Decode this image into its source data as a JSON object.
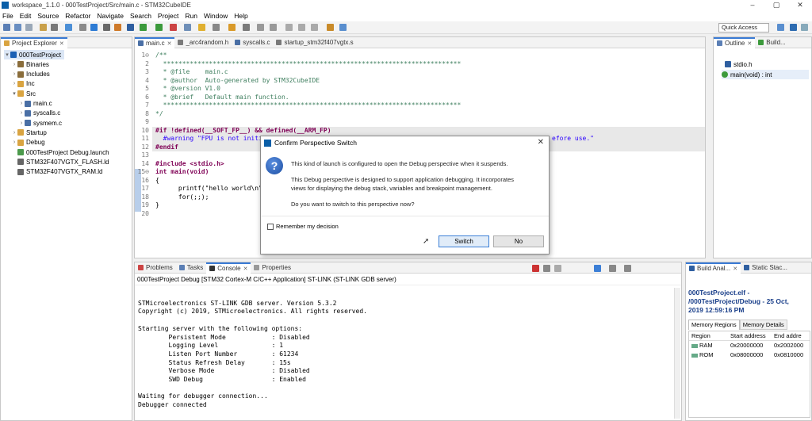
{
  "window": {
    "title": "workspace_1.1.0 - 000TestProject/Src/main.c - STM32CubeIDE"
  },
  "menu": [
    "File",
    "Edit",
    "Source",
    "Refactor",
    "Navigate",
    "Search",
    "Project",
    "Run",
    "Window",
    "Help"
  ],
  "quick_access": "Quick Access",
  "project_explorer": {
    "tab": "Project Explorer",
    "items": [
      {
        "label": "000TestProject",
        "level": 0,
        "arrow": "▾",
        "icon": "project-icon",
        "color": "#1a5fb4"
      },
      {
        "label": "Binaries",
        "level": 1,
        "arrow": "›",
        "icon": "binaries-icon",
        "color": "#8a6d3b"
      },
      {
        "label": "Includes",
        "level": 1,
        "arrow": "›",
        "icon": "includes-icon",
        "color": "#8a6d3b"
      },
      {
        "label": "Inc",
        "level": 1,
        "arrow": "›",
        "icon": "folder-icon",
        "color": "#d9a441"
      },
      {
        "label": "Src",
        "level": 1,
        "arrow": "▾",
        "icon": "folder-icon",
        "color": "#d9a441"
      },
      {
        "label": "main.c",
        "level": 2,
        "arrow": "›",
        "icon": "c-file-icon",
        "color": "#4a6fa5"
      },
      {
        "label": "syscalls.c",
        "level": 2,
        "arrow": "›",
        "icon": "c-file-icon",
        "color": "#4a6fa5"
      },
      {
        "label": "sysmem.c",
        "level": 2,
        "arrow": "›",
        "icon": "c-file-icon",
        "color": "#4a6fa5"
      },
      {
        "label": "Startup",
        "level": 1,
        "arrow": "›",
        "icon": "folder-icon",
        "color": "#d9a441"
      },
      {
        "label": "Debug",
        "level": 1,
        "arrow": "›",
        "icon": "folder-icon",
        "color": "#d9a441"
      },
      {
        "label": "000TestProject Debug.launch",
        "level": 1,
        "arrow": "",
        "icon": "launch-icon",
        "color": "#4c9a4c"
      },
      {
        "label": "STM32F407VGTX_FLASH.ld",
        "level": 1,
        "arrow": "",
        "icon": "ld-file-icon",
        "color": "#666666"
      },
      {
        "label": "STM32F407VGTX_RAM.ld",
        "level": 1,
        "arrow": "",
        "icon": "ld-file-icon",
        "color": "#666666"
      }
    ]
  },
  "editor": {
    "tabs": [
      "main.c",
      "_arc4random.h",
      "syscalls.c",
      "startup_stm32f407vgtx.s"
    ],
    "lines": [
      {
        "n": "1⊖",
        "t": "/**",
        "c": "cmt"
      },
      {
        "n": "2",
        "t": "  ******************************************************************************",
        "c": "cmt"
      },
      {
        "n": "3",
        "t": "  * @file    main.c",
        "c": "cmt"
      },
      {
        "n": "4",
        "t": "  * @author  Auto-generated by STM32CubeIDE",
        "c": "cmt"
      },
      {
        "n": "5",
        "t": "  * @version V1.0",
        "c": "cmt"
      },
      {
        "n": "6",
        "t": "  * @brief   Default main function.",
        "c": "cmt"
      },
      {
        "n": "7",
        "t": "  ******************************************************************************",
        "c": "cmt"
      },
      {
        "n": "8",
        "t": "*/",
        "c": "cmt"
      },
      {
        "n": "9",
        "t": "",
        "c": ""
      },
      {
        "n": "10",
        "t": "#if !defined(__SOFT_FP__) && defined(__ARM_FP)",
        "c": "kw"
      },
      {
        "n": "11",
        "t": "  #warning \"FPU is not initi",
        "c": "str"
      },
      {
        "n": "12",
        "t": "#endif",
        "c": "kw"
      },
      {
        "n": "13",
        "t": "",
        "c": ""
      },
      {
        "n": "14",
        "t": "#include <stdio.h>",
        "c": "kw"
      },
      {
        "n": "15⊖",
        "t": "int main(void)",
        "c": "kw"
      },
      {
        "n": "16",
        "t": "{",
        "c": ""
      },
      {
        "n": "17",
        "t": "      printf(\"hello world\\n\");",
        "c": ""
      },
      {
        "n": "18",
        "t": "      for(;;);",
        "c": ""
      },
      {
        "n": "19",
        "t": "}",
        "c": ""
      },
      {
        "n": "20",
        "t": "",
        "c": ""
      }
    ],
    "line11_tail": "efore use.\""
  },
  "outline": {
    "tabs": [
      "Outline",
      "Build..."
    ],
    "items": [
      "stdio.h",
      "main(void) : int"
    ]
  },
  "console": {
    "tabs": [
      "Problems",
      "Tasks",
      "Console",
      "Properties"
    ],
    "header": "000TestProject Debug [STM32 Cortex-M C/C++ Application] ST-LINK (ST-LINK GDB server)",
    "lines": [
      "",
      "STMicroelectronics ST-LINK GDB server. Version 5.3.2",
      "Copyright (c) 2019, STMicroelectronics. All rights reserved.",
      "",
      "Starting server with the following options:",
      "        Persistent Mode            : Disabled",
      "        Logging Level              : 1",
      "        Listen Port Number         : 61234",
      "        Status Refresh Delay       : 15s",
      "        Verbose Mode               : Disabled",
      "        SWD Debug                  : Enabled",
      "",
      "Waiting for debugger connection...",
      "Debugger connected"
    ]
  },
  "build_analyzer": {
    "tabs": [
      "Build Anal...",
      "Static Stac..."
    ],
    "title_line1": "000TestProject.elf -",
    "title_line2": "/000TestProject/Debug - 25 Oct,",
    "title_line3": "2019 12:59:16 PM",
    "subtabs": [
      "Memory Regions",
      "Memory Details"
    ],
    "columns": [
      "Region",
      "Start address",
      "End addre"
    ],
    "rows": [
      [
        "RAM",
        "0x20000000",
        "0x2002000"
      ],
      [
        "ROM",
        "0x08000000",
        "0x0810000"
      ]
    ]
  },
  "dialog": {
    "title": "Confirm Perspective Switch",
    "line1": "This kind of launch is configured to open the Debug perspective when it suspends.",
    "line2": "This Debug perspective is designed to support application debugging. It incorporates",
    "line3": "views for displaying the debug stack, variables and breakpoint management.",
    "line4": "Do you want to switch to this perspective now?",
    "remember": "Remember my decision",
    "switch": "Switch",
    "no": "No"
  }
}
